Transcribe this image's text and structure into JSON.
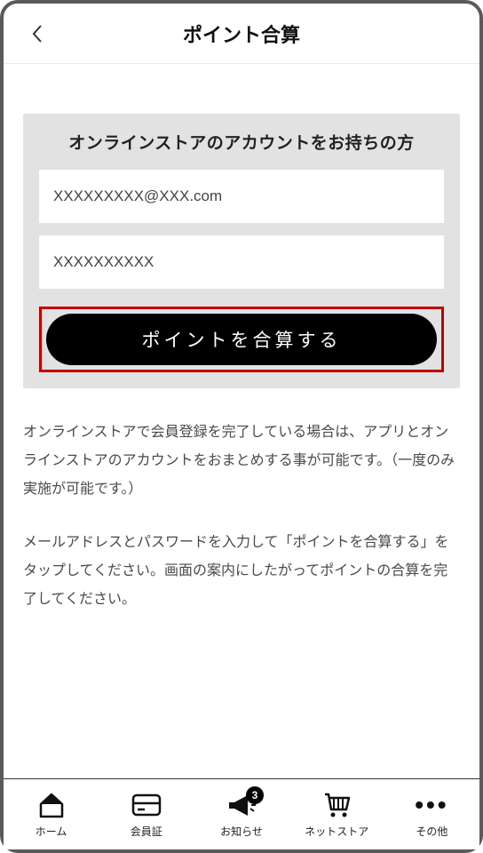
{
  "header": {
    "title": "ポイント合算"
  },
  "card": {
    "title": "オンラインストアのアカウントをお持ちの方",
    "email_value": "XXXXXXXXX@XXX.com",
    "password_value": "XXXXXXXXXX",
    "button_label": "ポイントを合算する"
  },
  "description": {
    "p1": "オンラインストアで会員登録を完了している場合は、アプリとオンラインストアのアカウントをおまとめする事が可能です。（一度のみ実施が可能です。）",
    "p2": "メールアドレスとパスワードを入力して「ポイントを合算する」をタップしてください。画面の案内にしたがってポイントの合算を完了してください。"
  },
  "nav": {
    "items": [
      {
        "label": "ホーム"
      },
      {
        "label": "会員証"
      },
      {
        "label": "お知らせ",
        "badge": "3"
      },
      {
        "label": "ネットストア"
      },
      {
        "label": "その他"
      }
    ]
  }
}
